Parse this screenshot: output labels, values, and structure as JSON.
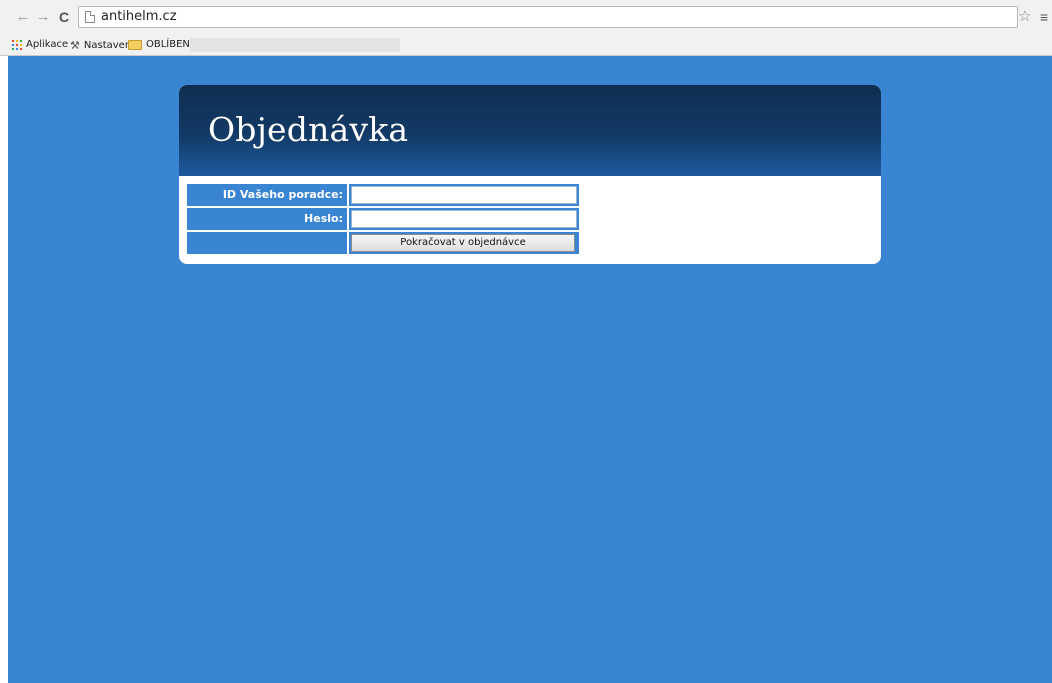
{
  "browser": {
    "back_icon": "arrow-left-icon",
    "forward_icon": "arrow-right-icon",
    "reload_icon": "reload-icon",
    "url": "antihelm.cz",
    "bookmarks": [
      {
        "label": "Aplikace",
        "icon": "apps-icon"
      },
      {
        "label": "Nastavení",
        "icon": "wrench-icon"
      },
      {
        "label": "OBLÍBENÉ",
        "icon": "folder-icon"
      }
    ]
  },
  "page": {
    "title": "Objednávka",
    "form": {
      "advisor_id_label": "ID Vašeho poradce:",
      "advisor_id_value": "",
      "password_label": "Heslo:",
      "password_value": "",
      "submit_label": "Pokračovat v objednávce"
    }
  },
  "colors": {
    "page_background": "#3a85d3",
    "header_dark": "#0f2d50",
    "header_light": "#1d5a9e",
    "label_background": "#3a85d3"
  }
}
